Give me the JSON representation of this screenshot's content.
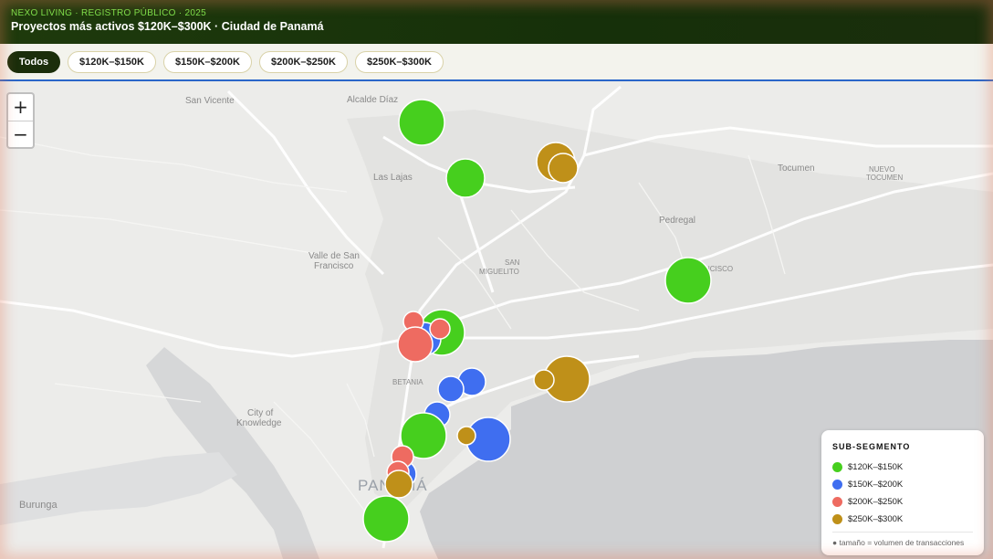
{
  "header": {
    "eyebrow": "NEXO LIVING · REGISTRO PÚBLICO · 2025",
    "title": "Proyectos más activos $120K–$300K · Ciudad de Panamá"
  },
  "filters": [
    {
      "label": "Todos",
      "active": true
    },
    {
      "label": "$120K–$150K",
      "active": false
    },
    {
      "label": "$150K–$200K",
      "active": false
    },
    {
      "label": "$200K–$250K",
      "active": false
    },
    {
      "label": "$250K–$300K",
      "active": false
    }
  ],
  "zoom": {
    "in_label": "+",
    "out_label": "−"
  },
  "map_labels": {
    "san_vicente": "San Vicente",
    "alcalde_diaz": "Alcalde Díaz",
    "las_lajas": "Las Lajas",
    "tocumen": "Tocumen",
    "nuevo": "NUEVO",
    "tocumen_caps": "TOCUMEN",
    "pedregal": "Pedregal",
    "valle_1": "Valle de San",
    "valle_2": "Francisco",
    "san": "SAN",
    "miguelito": "MIGUELITO",
    "francisco": "FRANCISCO",
    "betania": "BETANIA",
    "city_1": "City of",
    "city_2": "Knowledge",
    "panama": "PANAMÁ",
    "burunga": "Burunga"
  },
  "colors": {
    "s1": "#46cf1e",
    "s2": "#3f6ef0",
    "s3": "#ee6b61",
    "s4": "#bf9019"
  },
  "legend": {
    "title": "SUB-SEGMENTO",
    "items": [
      {
        "label": "$120K–$150K",
        "color": "#46cf1e"
      },
      {
        "label": "$150K–$200K",
        "color": "#3f6ef0"
      },
      {
        "label": "$200K–$250K",
        "color": "#ee6b61"
      },
      {
        "label": "$250K–$300K",
        "color": "#bf9019"
      }
    ],
    "note": "● tamaño = volumen de transacciones"
  }
}
